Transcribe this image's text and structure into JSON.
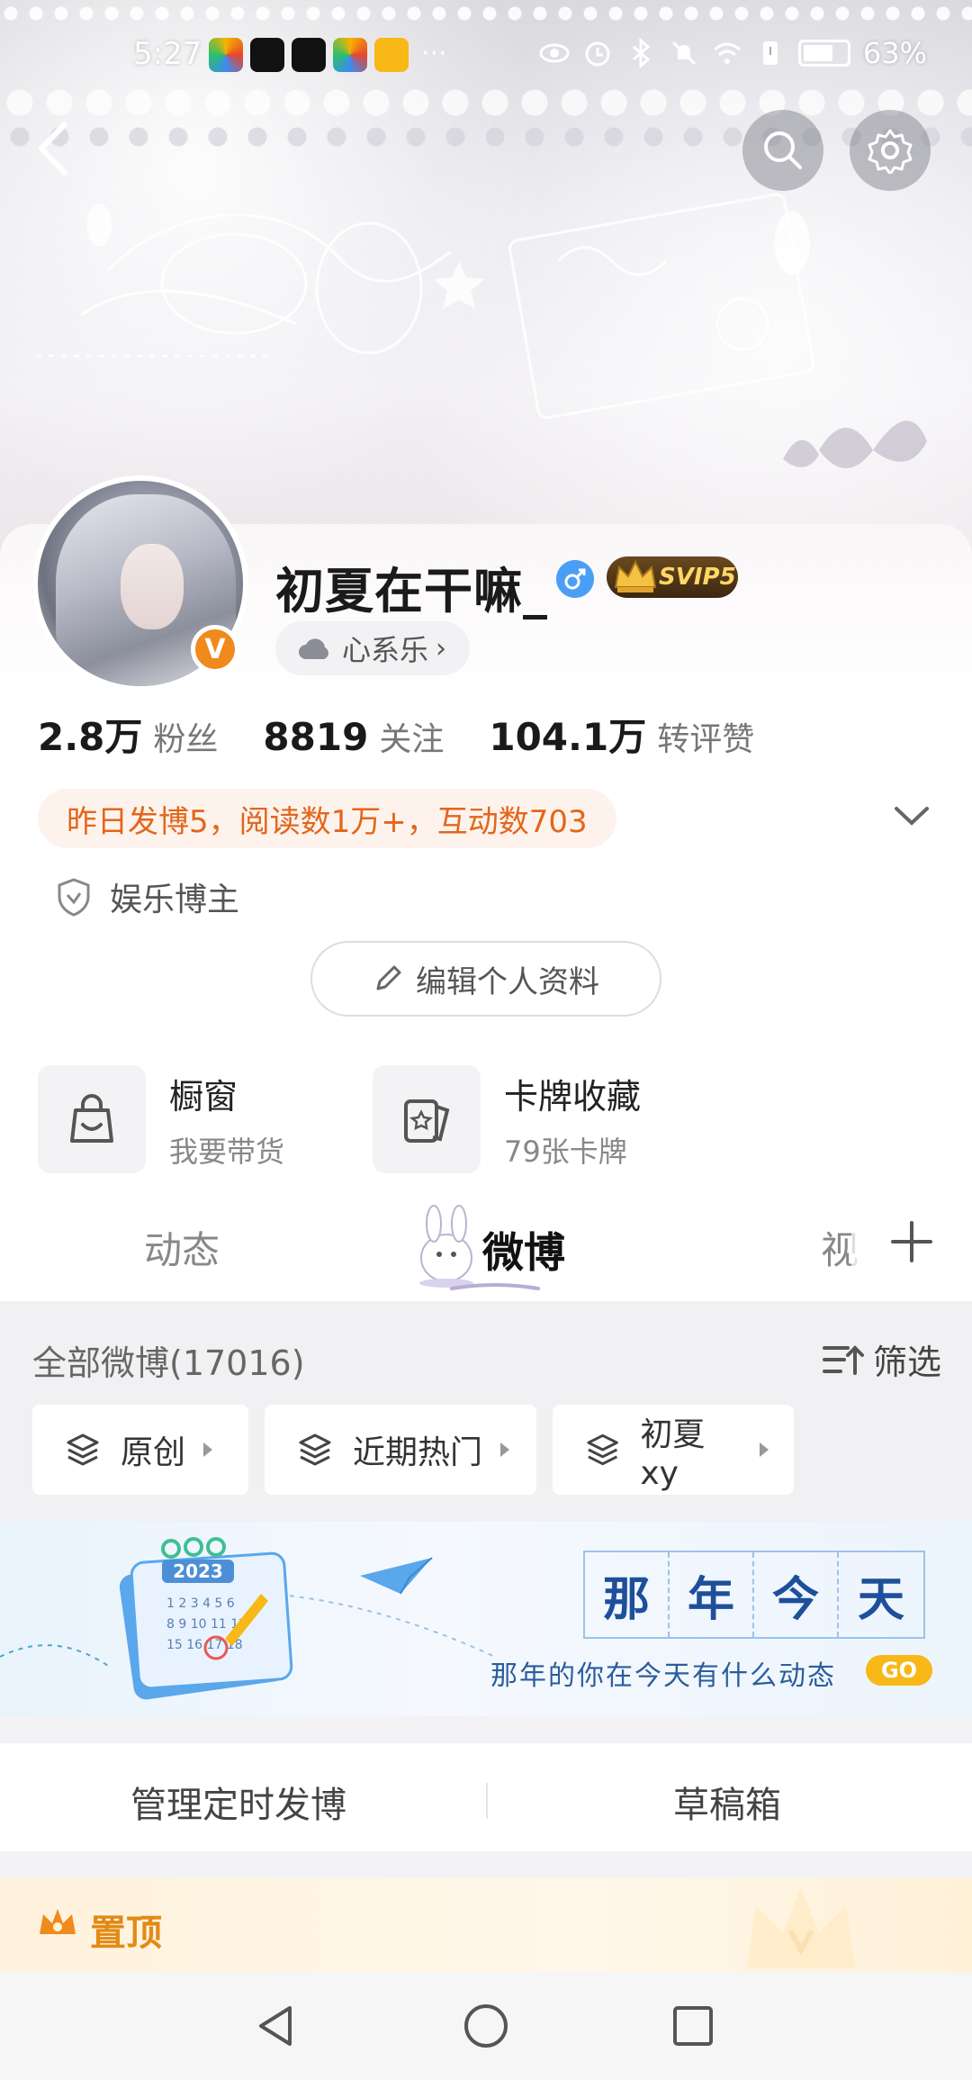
{
  "status_bar": {
    "time": "5:27",
    "battery": "63%"
  },
  "profile": {
    "username": "初夏在干嘛_",
    "gender": "male",
    "vip_badge": "SVIP5",
    "verified_badge": "V",
    "mood": "心系乐",
    "stats": [
      {
        "num": "2.8万",
        "label": "粉丝"
      },
      {
        "num": "8819",
        "label": "关注"
      },
      {
        "num": "104.1万",
        "label": "转评赞"
      }
    ],
    "insight": "昨日发博5，阅读数1万+，互动数703",
    "tag": "娱乐博主",
    "edit_button": "编辑个人资料"
  },
  "shortcuts": [
    {
      "title": "橱窗",
      "sub": "我要带货",
      "icon": "shopping-bag-icon"
    },
    {
      "title": "卡牌收藏",
      "sub": "79张卡牌",
      "icon": "card-icon"
    }
  ],
  "tabs": {
    "items": [
      "动态",
      "微博",
      "视"
    ],
    "active": "微博"
  },
  "feed": {
    "all_posts": "全部微博(17016)",
    "filter": "筛选",
    "chips": [
      "原创",
      "近期热门",
      "初夏xy"
    ]
  },
  "memory_banner": {
    "chars": [
      "那",
      "年",
      "今",
      "天"
    ],
    "subtitle": "那年的你在今天有什么动态",
    "go": "GO",
    "calendar_year": "2023"
  },
  "manage": {
    "scheduled": "管理定时发博",
    "drafts": "草稿箱"
  },
  "pinned": {
    "label": "置顶"
  },
  "colors": {
    "accent_orange": "#e3661c",
    "vip_gold": "#ffd766",
    "pinned_orange": "#e28a13",
    "memory_blue": "#1e4f9a"
  }
}
